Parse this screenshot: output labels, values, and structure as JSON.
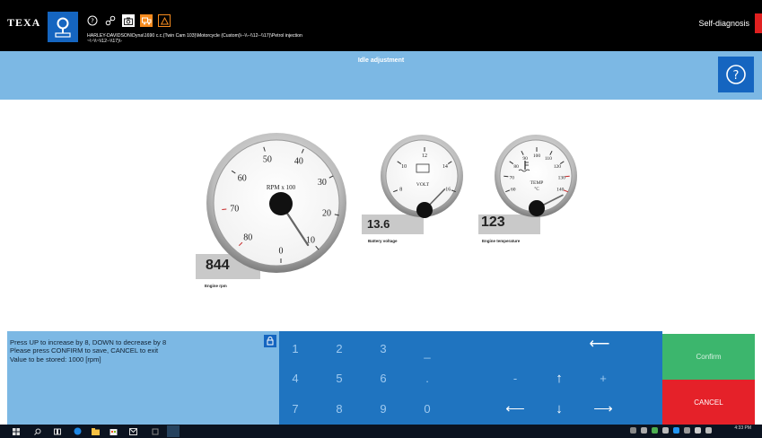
{
  "header": {
    "logo": "TEXA",
    "path": "HARLEY-DAVIDSON\\Dyna\\1690 c.c.(Twin Cam 103)\\Motorcycle (Custom)\\--\\\\--\\\\12--\\\\17)\\Petrol injection",
    "path2": "~\\~\\\\~\\\\12--\\\\17)\\-",
    "right_title": "Self-diagnosis",
    "icons": [
      "help-icon",
      "link-icon",
      "camera-icon",
      "truck-icon",
      "warning-icon"
    ]
  },
  "page": {
    "title": "Idle adjustment"
  },
  "gauges": {
    "rpm": {
      "value": "844",
      "value_numeric": 8.44,
      "label": "Engine rpm",
      "unit_label": "RPM x 100",
      "ticks": [
        "0",
        "10",
        "20",
        "30",
        "40",
        "50",
        "60",
        "70",
        "80"
      ],
      "min": 0,
      "max": 80
    },
    "voltage": {
      "value": "13.6",
      "value_numeric": 13.6,
      "label": "Battery voltage",
      "unit_label": "VOLT",
      "ticks": [
        "8",
        "10",
        "12",
        "14",
        "16"
      ],
      "min": 6,
      "max": 18
    },
    "temp": {
      "value": "123",
      "value_numeric": 123,
      "label": "Engine temperature",
      "unit_label": "TEMP",
      "unit_sub": "°C",
      "ticks": [
        "60",
        "70",
        "80",
        "90",
        "100",
        "110",
        "120",
        "130",
        "140"
      ],
      "min": 50,
      "max": 150
    }
  },
  "info": {
    "line1": "Press UP to increase by 8, DOWN to decrease by 8",
    "line2": "Please press CONFIRM to save, CANCEL to exit",
    "line3": "Value to be stored: 1000 [rpm]"
  },
  "keypad": {
    "k1": "1",
    "k2": "2",
    "k3": "3",
    "k_us": "_",
    "k_back": "⟵",
    "k4": "4",
    "k5": "5",
    "k6": "6",
    "k_dot": ".",
    "k_minus": "-",
    "k_up": "↑",
    "k_plus": "+",
    "k7": "7",
    "k8": "8",
    "k9": "9",
    "k0": "0",
    "k_left": "⟵",
    "k_down": "↓",
    "k_right": "⟶"
  },
  "actions": {
    "confirm": "Confirm",
    "cancel": "CANCEL"
  },
  "taskbar": {
    "time": "4:33 PM"
  },
  "colors": {
    "header_bg": "#000000",
    "title_band": "#7cb8e4",
    "accent_blue": "#1565c0",
    "keypad_bg": "#1f74c0",
    "confirm_green": "#3cb66d",
    "cancel_red": "#e52129",
    "orange": "#f68b1f"
  }
}
